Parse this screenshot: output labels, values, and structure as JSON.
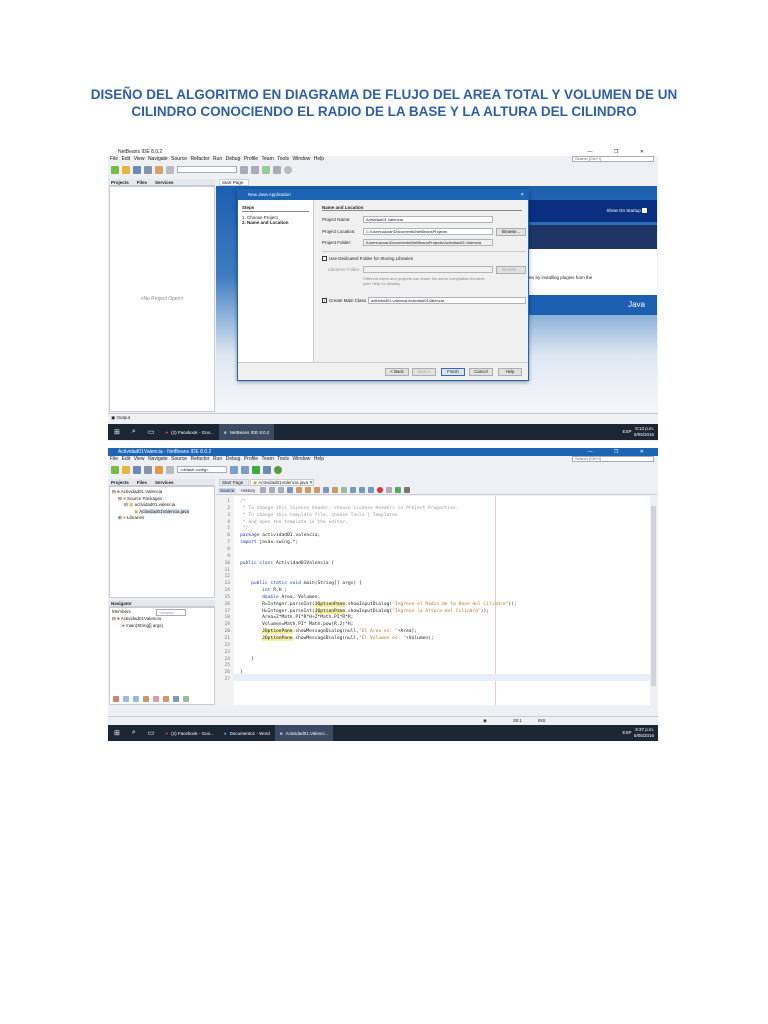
{
  "document": {
    "title": "DISEÑO DEL ALGORITMO EN DIAGRAMA DE FLUJO DEL AREA TOTAL Y VOLUMEN DE UN CILINDRO CONOCIENDO EL RADIO DE LA BASE Y LA ALTURA DEL CILINDRO"
  },
  "menu": [
    "File",
    "Edit",
    "View",
    "Navigate",
    "Source",
    "Refactor",
    "Run",
    "Debug",
    "Profile",
    "Team",
    "Tools",
    "Window",
    "Help"
  ],
  "search_placeholder": "Search (Ctrl+I)",
  "window_buttons": "—  ❐  ✕",
  "pane_tabs": {
    "projects": "Projects",
    "files": "Files",
    "services": "Services"
  },
  "shot1": {
    "window_title": "NetBeans IDE 8.0.2",
    "start_tab": "Start Page",
    "no_project": "<No Project Open>",
    "show_on_startup": "Show On Startup",
    "plugins_text": "technologies by installing plugins from the",
    "java_logo": "Java",
    "output_label": "Output",
    "dialog": {
      "title": "New Java Application",
      "steps_header": "Steps",
      "steps": [
        "1.  Choose Project",
        "2.  Name and Location"
      ],
      "section": "Name and Location",
      "project_name_label": "Project Name:",
      "project_name": "Actividad01.Valencia",
      "project_location_label": "Project Location:",
      "project_location": "C:\\Users\\acuar\\Documents\\NetBeansProjects",
      "project_folder_label": "Project Folder:",
      "project_folder": "\\Users\\acuar\\Documents\\NetBeansProjects\\Actividad01.Valencia",
      "browse": "Browse...",
      "dedicated_folder": "Use Dedicated Folder for Storing Libraries",
      "libraries_folder_label": "Libraries Folder:",
      "libraries_hint": "Different users and projects can share the same compilation libraries (see Help for details).",
      "create_main_class": "Create Main Class",
      "main_class": "actividad01.valencia.Actividad01Valencia",
      "buttons": {
        "back": "< Back",
        "next": "Next >",
        "finish": "Finish",
        "cancel": "Cancel",
        "help": "Help"
      }
    },
    "taskbar": {
      "apps": [
        "(2) Facebook - Goo...",
        "NetBeans IDE 8.0.2"
      ],
      "lang": "ESP",
      "time": "9:13 p.m.",
      "date": "5/05/2016"
    }
  },
  "shot2": {
    "window_title": "Actividad01Valencia - NetBeans IDE 8.0.2",
    "config": "<default config>",
    "tabs": [
      "Start Page",
      "Actividad01Valencia.java"
    ],
    "editor_modes": {
      "source": "Source",
      "history": "History"
    },
    "tree": [
      "Actividad01.Valencia",
      "Source Packages",
      "actividad01.valencia",
      "Actividad01Valencia.java",
      "Libraries"
    ],
    "navigator": {
      "title": "Navigator",
      "members": "Members",
      "filter": "<empty>",
      "class": "Actividad01Valencia",
      "method": "main(String[] args)"
    },
    "status": {
      "position": "29:1",
      "mode": "INS"
    },
    "code": [
      [
        [
          "/*",
          "cm"
        ]
      ],
      [
        [
          " * To change this license header, choose License Headers in Project Properties.",
          "cm"
        ]
      ],
      [
        [
          " * To change this template file, choose Tools | Templates",
          "cm"
        ]
      ],
      [
        [
          " * and open the template in the editor.",
          "cm"
        ]
      ],
      [
        [
          " */",
          "cm"
        ]
      ],
      [
        [
          "package",
          "kw"
        ],
        [
          " actividad01.valencia;",
          ""
        ]
      ],
      [
        [
          "import",
          "kw"
        ],
        [
          " javax.swing.*;",
          ""
        ]
      ],
      [],
      [],
      [
        [
          "public class",
          "kw"
        ],
        [
          " Actividad01Valencia {",
          ""
        ]
      ],
      [],
      [],
      [
        [
          "    public static void",
          "kw"
        ],
        [
          " main(String[] args) {",
          ""
        ]
      ],
      [
        [
          "        int",
          "kw"
        ],
        [
          " R,H ;",
          ""
        ]
      ],
      [
        [
          "        double",
          "kw"
        ],
        [
          " Area, Volumen;",
          ""
        ]
      ],
      [
        [
          "        R=Integer.parseInt(",
          ""
        ],
        [
          "JOptionPane",
          "hl"
        ],
        [
          ".showInputDialog(",
          ""
        ],
        [
          "\"Ingrese el Radio de la Base del Cilindro\"",
          "str"
        ],
        [
          "));",
          ""
        ]
      ],
      [
        [
          "        H=Integer.parseInt(",
          ""
        ],
        [
          "JOptionPane",
          "hl"
        ],
        [
          ".showInputDialog(",
          ""
        ],
        [
          "\"Ingrese la Altura del Cilindro\"",
          "str"
        ],
        [
          "));",
          ""
        ]
      ],
      [
        [
          "        Area=2*Math.PI*R*H+2*Math.PI*R*R;",
          ""
        ]
      ],
      [
        [
          "        Volumen=Math.PI* Math.pow(R,2)*H;",
          ""
        ]
      ],
      [
        [
          "        ",
          ""
        ],
        [
          "JOptionPane",
          "hl"
        ],
        [
          ".showMessageDialog(null,",
          ""
        ],
        [
          "\"El Area es: \"",
          "str"
        ],
        [
          "+Area);",
          ""
        ]
      ],
      [
        [
          "        ",
          ""
        ],
        [
          "JOptionPane",
          "hl"
        ],
        [
          ".showMessageDialog(null,",
          ""
        ],
        [
          "\"El Volumen es: \"",
          "str"
        ],
        [
          "+Volumen);",
          ""
        ]
      ],
      [],
      [],
      [
        [
          "    }",
          ""
        ]
      ],
      [],
      [
        [
          "}",
          ""
        ]
      ],
      []
    ],
    "taskbar": {
      "apps": [
        "(2) Facebook - Goo...",
        "Documento1 - Word",
        "Actividad01.Valenci..."
      ],
      "lang": "ESP",
      "time": "9:37 p.m.",
      "date": "5/05/2016"
    }
  }
}
